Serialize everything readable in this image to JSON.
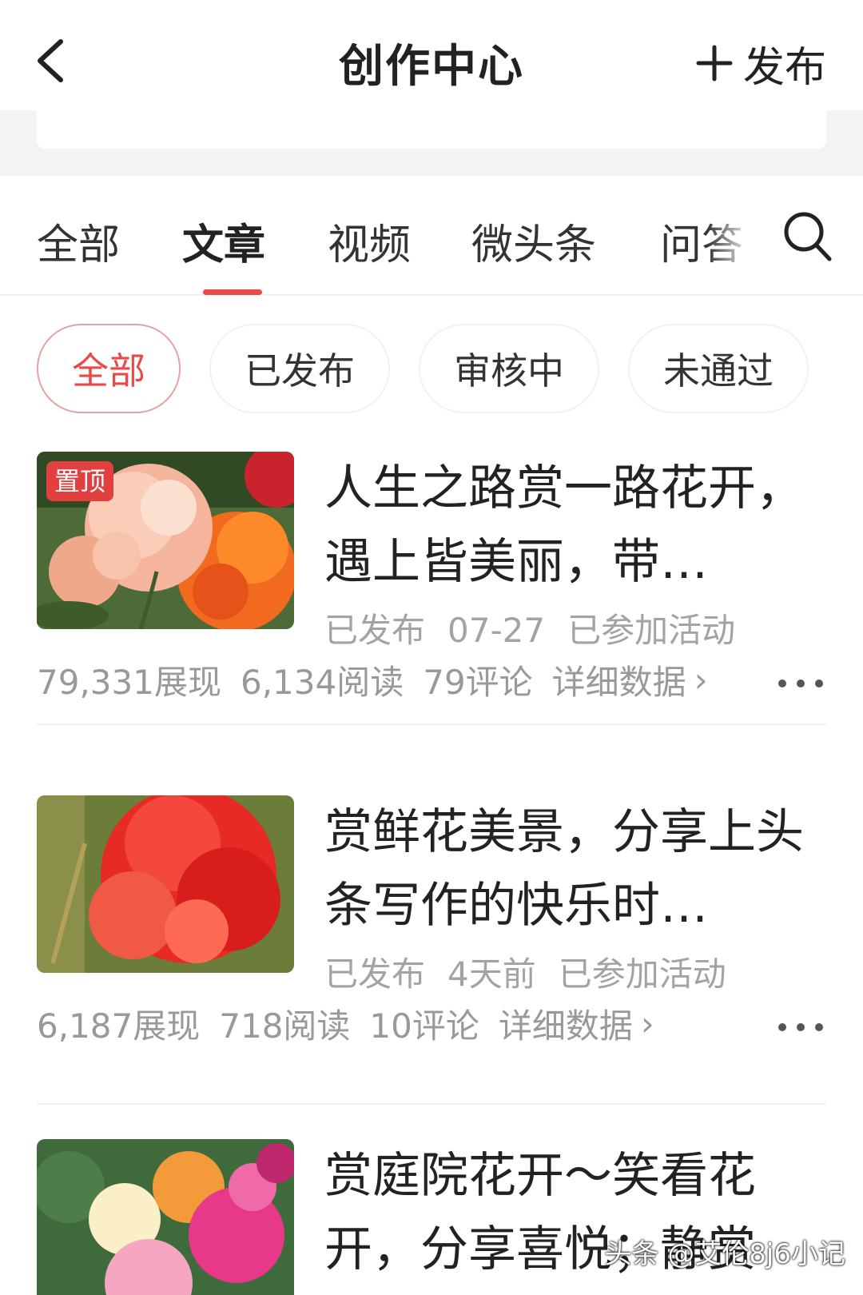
{
  "header": {
    "title": "创作中心",
    "publish_label": "发布"
  },
  "tabs": [
    {
      "label": "全部"
    },
    {
      "label": "文章"
    },
    {
      "label": "视频"
    },
    {
      "label": "微头条"
    },
    {
      "label": "问答"
    }
  ],
  "active_tab": "文章",
  "filters": [
    {
      "label": "全部"
    },
    {
      "label": "已发布"
    },
    {
      "label": "审核中"
    },
    {
      "label": "未通过"
    }
  ],
  "articles": [
    {
      "badge": "置顶",
      "title": "人生之路赏一路花开，遇上皆美丽，带…",
      "status": "已发布",
      "date": "07-27",
      "activity": "已参加活动",
      "impressions": "79,331展现",
      "reads": "6,134阅读",
      "comments": "79评论",
      "detail_link": "详细数据"
    },
    {
      "title": "赏鲜花美景，分享上头条写作的快乐时…",
      "status": "已发布",
      "date": "4天前",
      "activity": "已参加活动",
      "impressions": "6,187展现",
      "reads": "718阅读",
      "comments": "10评论",
      "detail_link": "详细数据"
    },
    {
      "title": "赏庭院花开～笑看花开，分享喜悦；静赏"
    }
  ],
  "watermark": "头条 @艾伦8j6小记",
  "colors": {
    "accent": "#e84a4a",
    "badge": "#e2403f",
    "muted_text": "#a3a3a3"
  },
  "icons": [
    "back-arrow-icon",
    "plus-icon",
    "search-icon",
    "chevron-right-icon",
    "more-dots-icon"
  ]
}
